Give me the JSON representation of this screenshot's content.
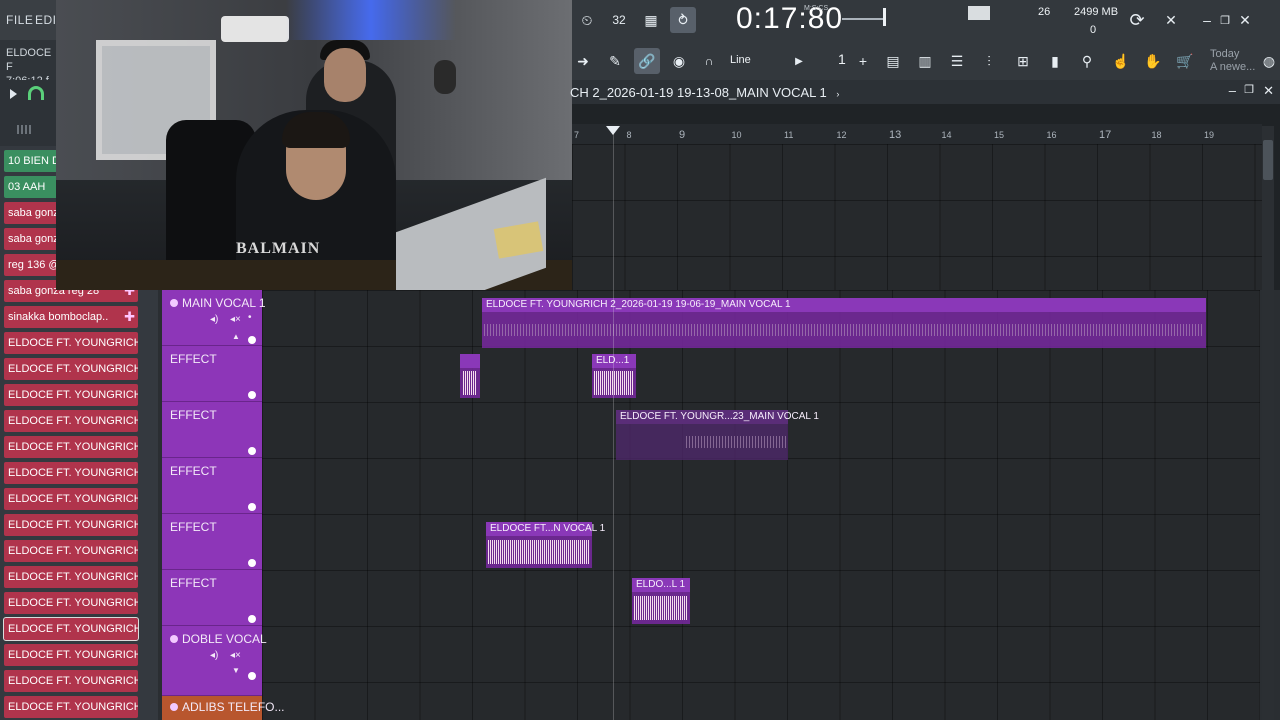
{
  "menu": {
    "file": "FILE",
    "edit": "EDI"
  },
  "hint_left": {
    "line1": "ELDOCE F",
    "line2": "7:06:12 f"
  },
  "picker_items": [
    {
      "label": "10 BIEN DI",
      "color": "green"
    },
    {
      "label": "03 AAH",
      "color": "green"
    },
    {
      "label": "saba gonz",
      "color": "red"
    },
    {
      "label": "saba gonz",
      "color": "red"
    },
    {
      "label": "reg 136 @",
      "color": "red"
    },
    {
      "label": "saba gonza reg 28",
      "color": "red"
    },
    {
      "label": "sinakka bomboclap..",
      "color": "red"
    },
    {
      "label": "ELDOCE FT. YOUNGRICH 2..",
      "color": "red"
    },
    {
      "label": "ELDOCE FT. YOUNGRICH 2..",
      "color": "red"
    },
    {
      "label": "ELDOCE FT. YOUNGRICH 2..",
      "color": "red"
    },
    {
      "label": "ELDOCE FT. YOUNGRICH 2..",
      "color": "red"
    },
    {
      "label": "ELDOCE FT. YOUNGRICH 2..",
      "color": "red"
    },
    {
      "label": "ELDOCE FT. YOUNGRICH 2..",
      "color": "red"
    },
    {
      "label": "ELDOCE FT. YOUNGRICH 2..",
      "color": "red"
    },
    {
      "label": "ELDOCE FT. YOUNGRICH 2..",
      "color": "red"
    },
    {
      "label": "ELDOCE FT. YOUNGRICH 2..",
      "color": "red"
    },
    {
      "label": "ELDOCE FT. YOUNGRICH 2..",
      "color": "red"
    },
    {
      "label": "ELDOCE FT. YOUNGRICH 2..",
      "color": "red"
    },
    {
      "label": "ELDOCE FT. YOUNGRICH 2..",
      "color": "red"
    },
    {
      "label": "ELDOCE FT. YOUNGRICH 2..",
      "color": "red"
    },
    {
      "label": "ELDOCE FT. YOUNGRICH 2..",
      "color": "red"
    },
    {
      "label": "ELDOCE FT. YOUNGRICH 2..",
      "color": "red"
    },
    {
      "label": "ELDOCE FT. YOUNGRICH 2..",
      "color": "red"
    }
  ],
  "transport": {
    "time": "0:17:80",
    "time_format": "M:S:CS",
    "cpu": "26",
    "memory": "2499 MB",
    "polyphony": "0",
    "snap": "Line",
    "step": "1",
    "hint_title": "Today",
    "hint_text": "A newe..."
  },
  "playlist": {
    "title": "CH 2_2026-01-19 19-13-08_MAIN VOCAL 1",
    "ruler": [
      "7",
      "8",
      "9",
      "10",
      "11",
      "12",
      "13",
      "14",
      "15",
      "16",
      "17",
      "18",
      "19"
    ]
  },
  "webcam": {
    "shirt_text": "BALMAIN"
  },
  "tracks": {
    "main_vocal": "MAIN VOCAL 1",
    "effect": "EFFECT",
    "doble_vocal": "DOBLE VOCAL",
    "adlibs": "ADLIBS TELEFO..."
  },
  "clips": {
    "main_long": "ELDOCE FT. YOUNGRICH 2_2026-01-19 19-06-19_MAIN VOCAL 1",
    "small_fx": "",
    "eld_short": "ELD...1",
    "main_mid": "ELDOCE FT. YOUNGR...23_MAIN VOCAL 1",
    "vocal_fx": "ELDOCE FT...N VOCAL 1",
    "eldo_l1": "ELDO...L 1"
  },
  "colors": {
    "track_purple": "#8a2fb5",
    "picker_red": "#b0344c",
    "picker_green": "#3a8f60"
  }
}
